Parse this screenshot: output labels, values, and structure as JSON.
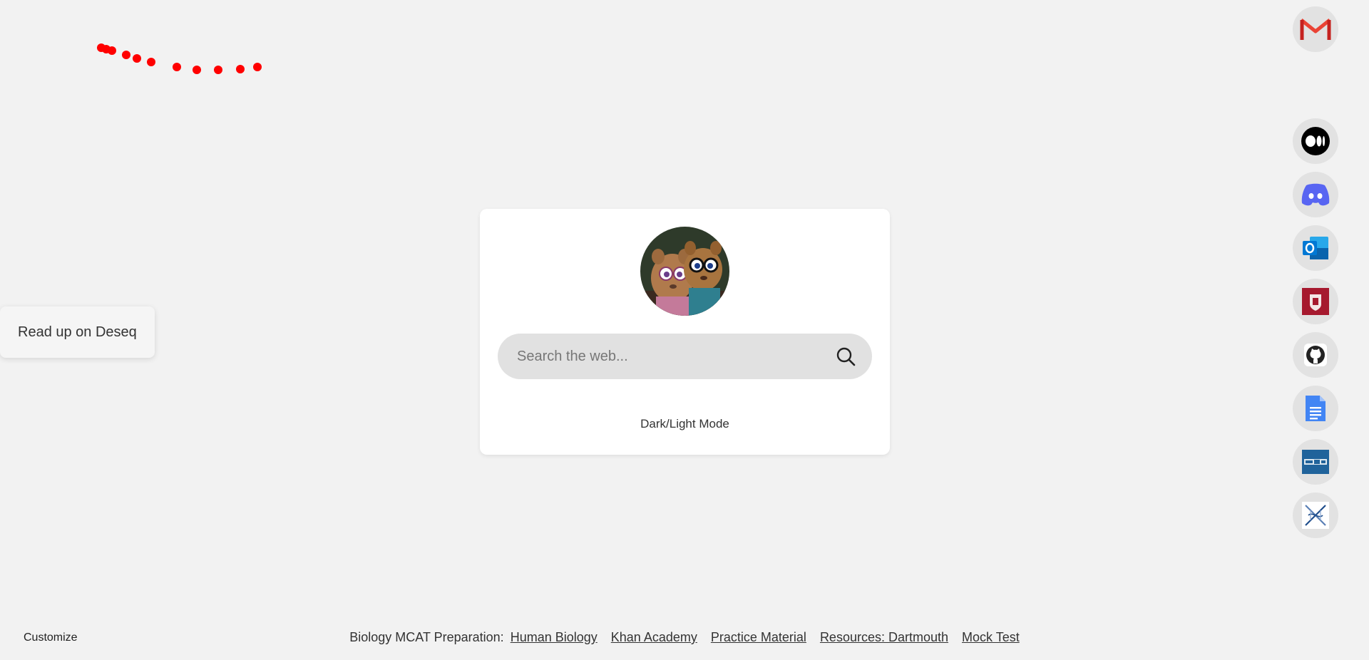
{
  "note": {
    "text": "Read up on Deseq"
  },
  "search": {
    "placeholder": "Search the web..."
  },
  "card": {
    "mode_toggle_label": "Dark/Light Mode"
  },
  "dock": {
    "items": [
      {
        "name": "gmail",
        "icon": "gmail-icon"
      },
      {
        "name": "medium",
        "icon": "medium-icon"
      },
      {
        "name": "discord",
        "icon": "discord-icon"
      },
      {
        "name": "outlook",
        "icon": "outlook-icon"
      },
      {
        "name": "dartmouth",
        "icon": "dartmouth-icon"
      },
      {
        "name": "github",
        "icon": "github-icon"
      },
      {
        "name": "google-docs",
        "icon": "google-docs-icon"
      },
      {
        "name": "pubmed",
        "icon": "pubmed-icon"
      },
      {
        "name": "dna",
        "icon": "dna-icon"
      }
    ]
  },
  "footer": {
    "customize_label": "Customize",
    "prefix": "Biology MCAT Preparation:",
    "links": [
      "Human Biology",
      "Khan Academy",
      "Practice Material",
      "Resources: Dartmouth",
      "Mock Test"
    ]
  },
  "colors": {
    "background": "#f2f2f2",
    "trail_dots": "#ff0000",
    "gmail_red": "#ea4335",
    "discord_blurple": "#5865f2",
    "outlook_blue": "#0078d4",
    "dartmouth_maroon": "#a6192e",
    "docs_blue": "#4285f4",
    "pubmed_blue": "#20639b"
  }
}
